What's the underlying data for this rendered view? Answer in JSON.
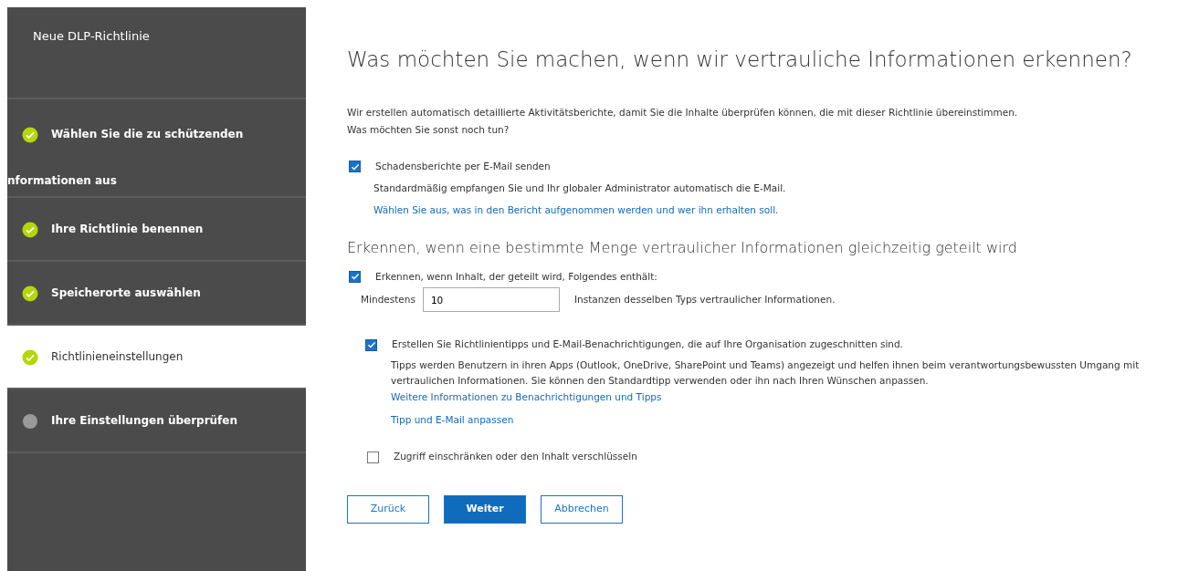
{
  "sidebar": {
    "title": "Neue DLP-Richtlinie",
    "steps": [
      {
        "label": "Wählen Sie die zu schützenden",
        "overflow": "nformationen aus",
        "completed": true,
        "selected": false
      },
      {
        "label": "Ihre Richtlinie benennen",
        "completed": true,
        "selected": false
      },
      {
        "label": "Speicherorte auswählen",
        "completed": true,
        "selected": false
      },
      {
        "label": "Richtlinieneinstellungen",
        "completed": true,
        "selected": true
      },
      {
        "label": "Ihre Einstellungen überprüfen",
        "completed": false,
        "selected": false
      }
    ]
  },
  "main": {
    "heading": "Was möchten Sie machen, wenn wir vertrauliche Informationen erkennen?",
    "intro": [
      "Wir erstellen automatisch detaillierte Aktivitätsberichte, damit Sie die Inhalte überprüfen können, die mit dieser Richtlinie übereinstimmen.",
      "Was möchten Sie sonst noch tun?"
    ],
    "report": {
      "label": "Schadensberichte per E-Mail senden",
      "checked": true,
      "note": "Standardmäßig empfangen Sie und Ihr globaler Administrator automatisch die E-Mail.",
      "link": "Wählen Sie aus, was in den Bericht aufgenommen werden und wer ihn erhalten soll."
    },
    "section_heading": "Erkennen, wenn eine bestimmte Menge vertraulicher Informationen gleichzeitig geteilt wird",
    "detect": {
      "label": "Erkennen, wenn Inhalt, der geteilt wird, Folgendes enthält:",
      "checked": true,
      "min_label": "Mindestens",
      "min_value": "10",
      "min_suffix": "Instanzen desselben Typs vertraulicher Informationen."
    },
    "tips": {
      "label": "Erstellen Sie Richtlinientipps und E-Mail-Benachrichtigungen, die auf Ihre Organisation zugeschnitten sind.",
      "checked": true,
      "text": "Tipps werden Benutzern in ihren Apps (Outlook, OneDrive, SharePoint und Teams) angezeigt und helfen ihnen beim verantwortungsbewussten Umgang mit vertraulichen Informationen. Sie können den Standardtipp verwenden oder ihn nach Ihren Wünschen anpassen.",
      "more_link": "Weitere Informationen zu Benachrichtigungen und Tipps",
      "customize_link": "Tipp und E-Mail anpassen"
    },
    "restrict": {
      "label": "Zugriff einschränken oder den Inhalt verschlüsseln",
      "checked": false
    },
    "buttons": [
      {
        "label": "Zurück",
        "kind": "secondary"
      },
      {
        "label": "Weiter",
        "kind": "primary"
      },
      {
        "label": "Abbrechen",
        "kind": "secondary"
      }
    ]
  }
}
